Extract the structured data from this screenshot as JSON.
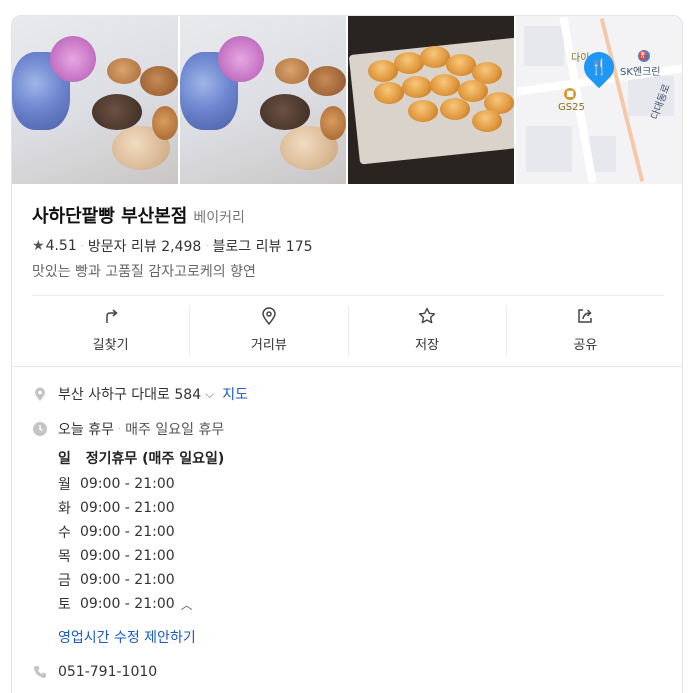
{
  "place": {
    "name": "사하단팥빵 부산본점",
    "category": "베이커리",
    "rating": "4.51",
    "visitor_reviews": "방문자 리뷰 2,498",
    "blog_reviews": "블로그 리뷰 175",
    "description": "맛있는 빵과 고품질 감자고로케의 향연"
  },
  "map": {
    "labels": [
      "다이",
      "SK엔크린",
      "GS25",
      "다대동로"
    ]
  },
  "actions": [
    {
      "label": "길찾기",
      "icon": "directions-icon"
    },
    {
      "label": "거리뷰",
      "icon": "map-pin-icon"
    },
    {
      "label": "저장",
      "icon": "star-icon"
    },
    {
      "label": "공유",
      "icon": "share-icon"
    }
  ],
  "info": {
    "address": "부산 사하구 다대로 584",
    "map_link": "지도",
    "today_status": "오늘 휴무",
    "regular_closure": "매주 일요일 휴무",
    "closed_day": "일",
    "closed_label": "정기휴무 (매주 일요일)",
    "hours": [
      {
        "day": "월",
        "time": "09:00 - 21:00"
      },
      {
        "day": "화",
        "time": "09:00 - 21:00"
      },
      {
        "day": "수",
        "time": "09:00 - 21:00"
      },
      {
        "day": "목",
        "time": "09:00 - 21:00"
      },
      {
        "day": "금",
        "time": "09:00 - 21:00"
      },
      {
        "day": "토",
        "time": "09:00 - 21:00"
      }
    ],
    "suggest_edit": "영업시간 수정 제안하기",
    "phone": "051-791-1010"
  },
  "colors": {
    "link": "#1a5bc4",
    "pin": "#1f97f5"
  }
}
